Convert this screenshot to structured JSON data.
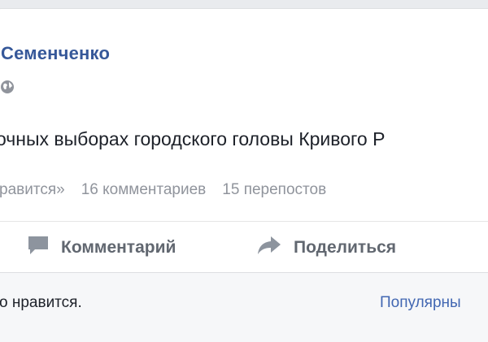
{
  "post": {
    "author": "Семенченко",
    "text": "очных выборах городского головы Кривого Р",
    "icons": {
      "audience": "globe-icon"
    }
  },
  "stats": {
    "likes": "равится»",
    "comments": "16 комментариев",
    "shares": "15 перепостов"
  },
  "actions": {
    "comment_label": "Комментарий",
    "share_label": "Поделиться",
    "icons": {
      "comment": "comment-icon",
      "share": "share-arrow-icon"
    }
  },
  "footer": {
    "likes_text": "о нравится.",
    "sort_label": "Популярны"
  },
  "colors": {
    "author": "#365899",
    "link": "#4267b2",
    "muted": "#90949c",
    "action": "#616770",
    "background": "#e9ebee",
    "footer_bg": "#f6f7f9"
  }
}
